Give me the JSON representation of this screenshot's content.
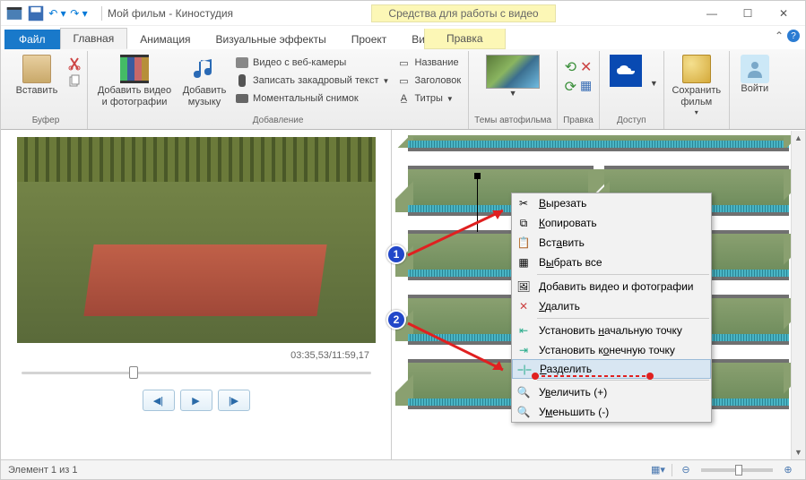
{
  "titlebar": {
    "title": "Мой фильм - Киностудия",
    "context_tab": "Средства для работы с видео"
  },
  "tabs": {
    "file": "Файл",
    "home": "Главная",
    "animation": "Анимация",
    "visual": "Визуальные эффекты",
    "project": "Проект",
    "view": "Вид",
    "edit": "Правка"
  },
  "ribbon": {
    "buffer": {
      "paste": "Вставить",
      "label": "Буфер"
    },
    "add": {
      "video_photo": "Добавить видео и фотографии",
      "music": "Добавить музыку",
      "webcam": "Видео с веб-камеры",
      "narration": "Записать закадровый текст",
      "snapshot": "Моментальный снимок",
      "title": "Название",
      "caption": "Заголовок",
      "credits": "Титры",
      "label": "Добавление"
    },
    "themes": {
      "label": "Темы автофильма"
    },
    "edit": {
      "label": "Правка"
    },
    "access": {
      "label": "Доступ"
    },
    "save": {
      "label": "Сохранить фильм"
    },
    "signin": {
      "label": "Войти"
    }
  },
  "preview": {
    "timecode": "03:35,53/11:59,17"
  },
  "ctxmenu": {
    "cut": "Вырезать",
    "copy": "Копировать",
    "paste": "Вставить",
    "select_all": "Выбрать все",
    "add_media": "Добавить видео и фотографии",
    "delete": "Удалить",
    "start_point": "Установить начальную точку",
    "end_point": "Установить конечную точку",
    "split": "Разделить",
    "zoom_in": "Увеличить (+)",
    "zoom_out": "Уменьшить (-)"
  },
  "markers": {
    "m1": "1",
    "m2": "2"
  },
  "statusbar": {
    "text": "Элемент 1 из 1"
  }
}
